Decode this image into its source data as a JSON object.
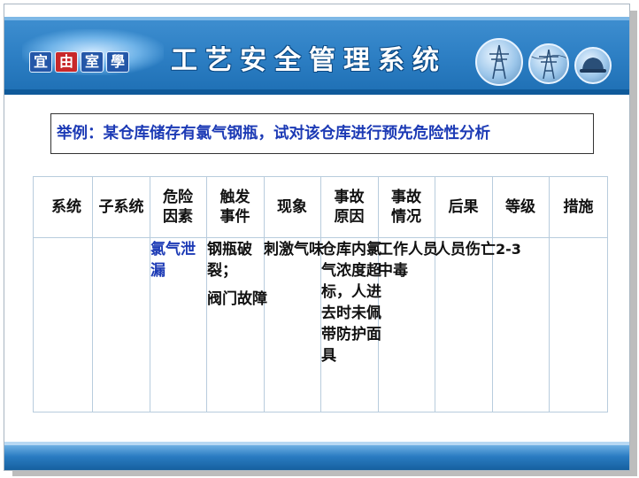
{
  "header": {
    "logo_chars": [
      "宜",
      "由",
      "室",
      "學"
    ],
    "title": "工艺安全管理系统"
  },
  "question": "举例：某仓库储存有氯气钢瓶，试对该仓库进行预先危险性分析",
  "table": {
    "headers": [
      "系统",
      "子系统",
      "危险\n因素",
      "触发\n事件",
      "现象",
      "事故\n原因",
      "事故\n情况",
      "后果",
      "等级",
      "措施"
    ],
    "row": {
      "system": "",
      "subsystem": "",
      "hazard": "氯气泄漏",
      "trigger_1": "钢瓶破裂；",
      "trigger_2": "阀门故障",
      "phenomenon": "刺激气味",
      "cause": "仓库内氯气浓度超标，人进去时未佩带防护面具",
      "situation": "工作人员中毒",
      "consequence": "人员伤亡",
      "grade": "2-3",
      "measures": ""
    }
  },
  "colors": {
    "banner": "#2d7fc4",
    "question_text": "#1c3ab5",
    "hazard_text": "#1c3ab5",
    "grid_lines": "#b8ccdd"
  }
}
